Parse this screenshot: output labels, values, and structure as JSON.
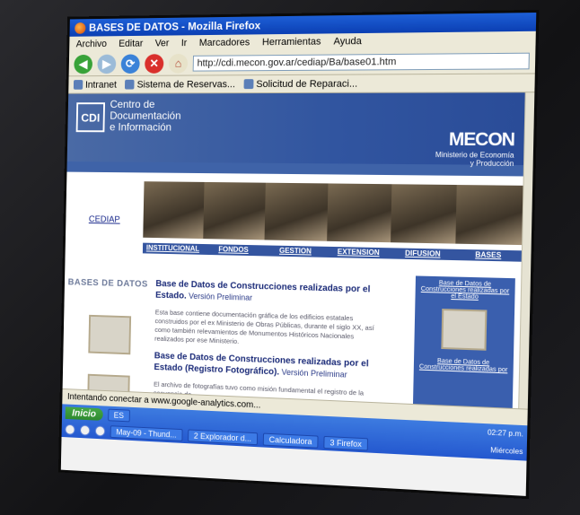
{
  "window": {
    "title": "BASES DE DATOS - Mozilla Firefox"
  },
  "menu": [
    "Archivo",
    "Editar",
    "Ver",
    "Ir",
    "Marcadores",
    "Herramientas",
    "Ayuda"
  ],
  "address": {
    "url": "http://cdi.mecon.gov.ar/cediap/Ba/base01.htm"
  },
  "bookmarks": [
    "Intranet",
    "Sistema de Reservas...",
    "Solicitud de Reparaci..."
  ],
  "banner": {
    "logo": "CDI",
    "line1": "Centro de",
    "line2": "Documentación",
    "line3": "e Información",
    "brand": "MECON",
    "brand_sub1": "Ministerio de Economía",
    "brand_sub2": "y Producción"
  },
  "nav": {
    "home": "CEDIAP",
    "items": [
      "INSTITUCIONAL",
      "FONDOS",
      "GESTION",
      "EXTENSION",
      "DIFUSION",
      "BASES"
    ]
  },
  "sidebar": {
    "title": "BASES DE DATOS"
  },
  "main": {
    "entry1_title": "Base de Datos de Construcciones realizadas por el Estado.",
    "entry1_version": "Versión Preliminar",
    "entry1_body": "Esta base contiene documentación gráfica de los edificios estatales construidos por el ex Ministerio de Obras Públicas, durante el siglo XX, así como también relevamientos de Monumentos Históricos Nacionales realizados por ese Ministerio.",
    "entry2_title": "Base de Datos de Construcciones realizadas por el Estado (Registro Fotográfico).",
    "entry2_version": "Versión Preliminar",
    "entry2_body": "El archivo de fotografías tuvo como misión fundamental el registro de la secuencia de"
  },
  "right_panel": {
    "link1": "Base de Datos de Construcciones realizadas por el Estado",
    "link2": "Base de Datos de Construcciones realizadas por"
  },
  "status": {
    "text": "Intentando conectar a www.google-analytics.com..."
  },
  "taskbar": {
    "start": "Inicio",
    "lang": "ES",
    "buttons": [
      "May-09 - Thund...",
      "2 Explorador d...",
      "Calculadora",
      "3 Firefox"
    ],
    "clock": "02:27 p.m.",
    "day": "Miércoles"
  }
}
